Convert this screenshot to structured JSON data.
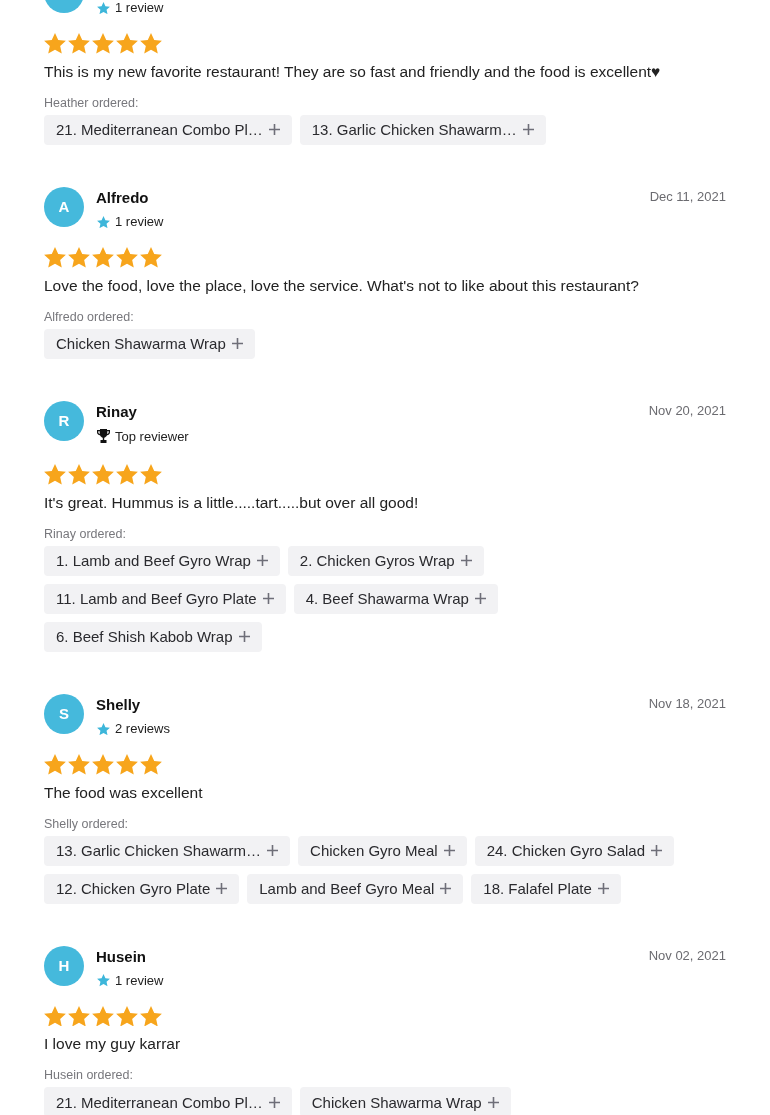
{
  "reviews": [
    {
      "badge": {
        "kind": "reviews",
        "label": "1 review"
      },
      "stars": 5,
      "text": "This is my new favorite restaurant! They are so fast and friendly and the food is excellent♥",
      "ordered_label": "Heather ordered:",
      "items": [
        "21. Mediterranean Combo Pl…",
        "13. Garlic Chicken Shawarm…"
      ]
    },
    {
      "initial": "A",
      "name": "Alfredo",
      "date": "Dec 11, 2021",
      "badge": {
        "kind": "reviews",
        "label": "1 review"
      },
      "stars": 5,
      "text": "Love the food, love the place, love the service. What's not to like about this restaurant?",
      "ordered_label": "Alfredo ordered:",
      "items": [
        "Chicken Shawarma Wrap"
      ]
    },
    {
      "initial": "R",
      "name": "Rinay",
      "date": "Nov 20, 2021",
      "badge": {
        "kind": "top",
        "label": "Top reviewer"
      },
      "stars": 5,
      "text": "It's great. Hummus is a little.....tart.....but over all good!",
      "ordered_label": "Rinay ordered:",
      "items": [
        "1. Lamb and Beef Gyro Wrap",
        "2. Chicken Gyros Wrap",
        "11. Lamb and Beef Gyro Plate",
        "4. Beef Shawarma Wrap",
        "6. Beef Shish Kabob Wrap"
      ]
    },
    {
      "initial": "S",
      "name": "Shelly",
      "date": "Nov 18, 2021",
      "badge": {
        "kind": "reviews",
        "label": "2 reviews"
      },
      "stars": 5,
      "text": "The food was excellent",
      "ordered_label": "Shelly ordered:",
      "items": [
        "13. Garlic Chicken Shawarm…",
        "Chicken Gyro Meal",
        "24. Chicken Gyro Salad",
        "12. Chicken Gyro Plate",
        "Lamb and Beef Gyro Meal",
        "18. Falafel Plate"
      ]
    },
    {
      "initial": "H",
      "name": "Husein",
      "date": "Nov 02, 2021",
      "badge": {
        "kind": "reviews",
        "label": "1 review"
      },
      "stars": 5,
      "text": "I love my guy karrar",
      "ordered_label": "Husein ordered:",
      "items": [
        "21. Mediterranean Combo Pl…",
        "Chicken Shawarma Wrap"
      ]
    }
  ]
}
